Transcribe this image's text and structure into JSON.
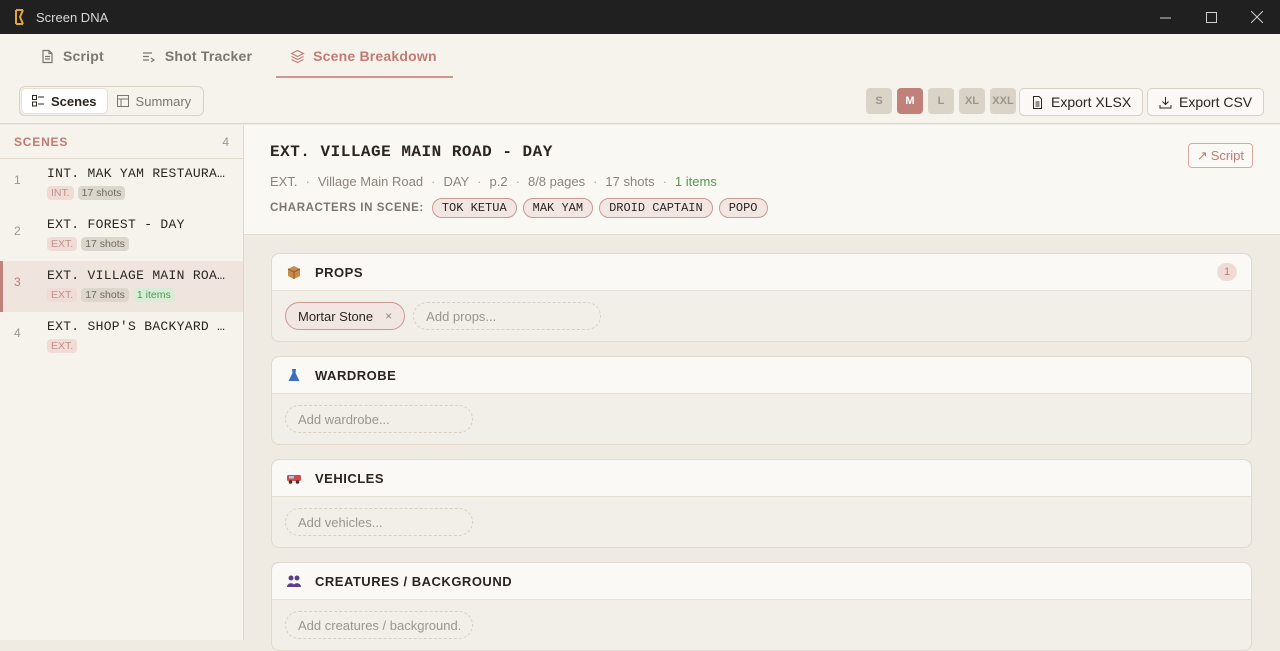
{
  "window": {
    "title": "Screen DNA"
  },
  "tabs": [
    {
      "label": "Script",
      "active": false
    },
    {
      "label": "Shot Tracker",
      "active": false
    },
    {
      "label": "Scene Breakdown",
      "active": true
    }
  ],
  "view_toggle": {
    "scenes_label": "Scenes",
    "summary_label": "Summary",
    "active": "Scenes"
  },
  "sizes": [
    "S",
    "M",
    "L",
    "XL",
    "XXL"
  ],
  "selected_size": "M",
  "export": {
    "xlsx_label": "Export XLSX",
    "csv_label": "Export CSV"
  },
  "sidebar": {
    "title": "SCENES",
    "count": "4",
    "scenes": [
      {
        "num": "1",
        "name": "INT. MAK YAM RESTAURANT",
        "tags": [
          "INT.",
          "17 shots"
        ]
      },
      {
        "num": "2",
        "name": "EXT. FOREST - DAY",
        "tags": [
          "EXT.",
          "17 shots"
        ]
      },
      {
        "num": "3",
        "name": "EXT. VILLAGE MAIN ROAD - DAY",
        "tags": [
          "EXT.",
          "17 shots",
          "1 items"
        ],
        "selected": true
      },
      {
        "num": "4",
        "name": "EXT. SHOP'S BACKYARD - DAY",
        "tags": [
          "EXT."
        ]
      }
    ]
  },
  "scene": {
    "title": "EXT. VILLAGE MAIN ROAD - DAY",
    "meta": [
      "EXT.",
      "Village Main Road",
      "DAY",
      "p.2",
      "8/8 pages",
      "17 shots"
    ],
    "items_text": "1 items",
    "characters_label": "CHARACTERS IN SCENE:",
    "characters": [
      "TOK KETUA",
      "MAK YAM",
      "DROID CAPTAIN",
      "POPO"
    ],
    "script_link": "Script"
  },
  "categories": [
    {
      "title": "PROPS",
      "icon": "package-icon",
      "count": "1",
      "items": [
        "Mortar Stone"
      ],
      "placeholder": "Add props..."
    },
    {
      "title": "WARDROBE",
      "icon": "dress-icon",
      "count": "",
      "items": [],
      "placeholder": "Add wardrobe..."
    },
    {
      "title": "VEHICLES",
      "icon": "vehicle-icon",
      "count": "",
      "items": [],
      "placeholder": "Add vehicles..."
    },
    {
      "title": "CREATURES / BACKGROUND",
      "icon": "people-icon",
      "count": "",
      "items": [],
      "placeholder": "Add creatures / background..."
    }
  ],
  "colors": {
    "accent": "#c27b74",
    "size_active": "#c0817a",
    "green": "#4f9a50"
  }
}
